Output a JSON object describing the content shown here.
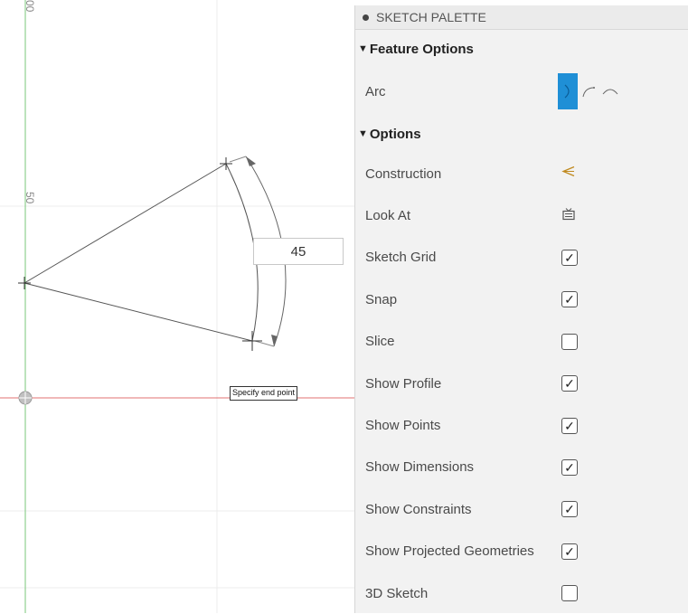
{
  "canvas": {
    "dimension_value": "45",
    "tooltip": "Specify end point",
    "axis_labels": [
      "50",
      "00"
    ]
  },
  "palette": {
    "title": "SKETCH PALETTE",
    "sections": {
      "feature_options": "Feature Options",
      "options": "Options"
    },
    "arc_label": "Arc",
    "rows": [
      {
        "label": "Construction",
        "control": "construction-icon"
      },
      {
        "label": "Look At",
        "control": "look-at-icon"
      },
      {
        "label": "Sketch Grid",
        "checked": true
      },
      {
        "label": "Snap",
        "checked": true
      },
      {
        "label": "Slice",
        "checked": false
      },
      {
        "label": "Show Profile",
        "checked": true
      },
      {
        "label": "Show Points",
        "checked": true
      },
      {
        "label": "Show Dimensions",
        "checked": true
      },
      {
        "label": "Show Constraints",
        "checked": true
      },
      {
        "label": "Show Projected Geometries",
        "checked": true
      },
      {
        "label": "3D Sketch",
        "checked": false
      }
    ],
    "colors": {
      "accent": "#1f8fd6"
    }
  }
}
